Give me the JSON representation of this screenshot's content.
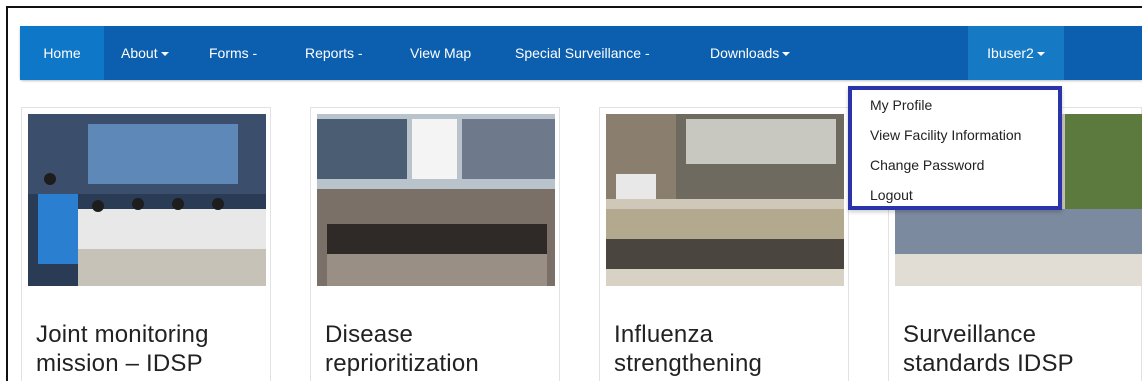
{
  "navbar": {
    "items": [
      {
        "label": "Home",
        "caret": false
      },
      {
        "label": "About",
        "caret": true
      },
      {
        "label": "Forms -",
        "caret": true
      },
      {
        "label": "Reports -",
        "caret": true
      },
      {
        "label": "View Map",
        "caret": false
      },
      {
        "label": "Special Surveillance -",
        "caret": true
      },
      {
        "label": "Downloads",
        "caret": true
      }
    ],
    "user": {
      "label": "Ibuser2"
    }
  },
  "user_menu": {
    "items": [
      "My Profile",
      "View Facility Information",
      "Change Password",
      "Logout"
    ]
  },
  "cards": [
    {
      "title_line1": "Joint monitoring",
      "title_line2": "mission – IDSP"
    },
    {
      "title_line1": "Disease",
      "title_line2": "reprioritization"
    },
    {
      "title_line1": "Influenza",
      "title_line2": "strengthening"
    },
    {
      "title_line1": "Surveillance",
      "title_line2": "standards IDSP"
    }
  ],
  "colors": {
    "navbar": "#0b5fae",
    "active_item": "#0f77c7",
    "dropdown_border": "#2b33a8"
  }
}
